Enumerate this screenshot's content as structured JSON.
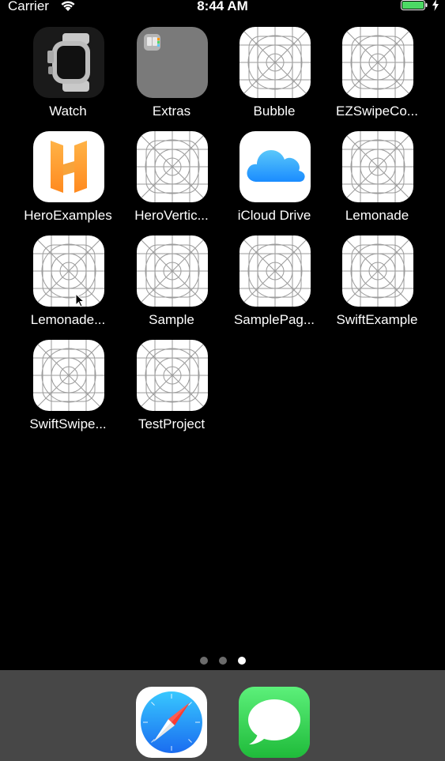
{
  "status_bar": {
    "carrier": "Carrier",
    "time": "8:44 AM",
    "battery_color": "#4cd964"
  },
  "apps": [
    {
      "label": "Watch",
      "icon": "watch-icon"
    },
    {
      "label": "Extras",
      "icon": "folder-icon"
    },
    {
      "label": "Bubble",
      "icon": "app-placeholder-icon"
    },
    {
      "label": "EZSwipeCo...",
      "icon": "app-placeholder-icon"
    },
    {
      "label": "HeroExamples",
      "icon": "hero-icon"
    },
    {
      "label": "HeroVertic...",
      "icon": "app-placeholder-icon"
    },
    {
      "label": "iCloud Drive",
      "icon": "icloud-icon"
    },
    {
      "label": "Lemonade",
      "icon": "app-placeholder-icon"
    },
    {
      "label": "Lemonade...",
      "icon": "app-placeholder-icon"
    },
    {
      "label": "Sample",
      "icon": "app-placeholder-icon"
    },
    {
      "label": "SamplePag...",
      "icon": "app-placeholder-icon"
    },
    {
      "label": "SwiftExample",
      "icon": "app-placeholder-icon"
    },
    {
      "label": "SwiftSwipe...",
      "icon": "app-placeholder-icon"
    },
    {
      "label": "TestProject",
      "icon": "app-placeholder-icon"
    }
  ],
  "page_indicator": {
    "total": 3,
    "current": 3
  },
  "dock": [
    {
      "icon": "safari-icon"
    },
    {
      "icon": "messages-icon"
    }
  ]
}
